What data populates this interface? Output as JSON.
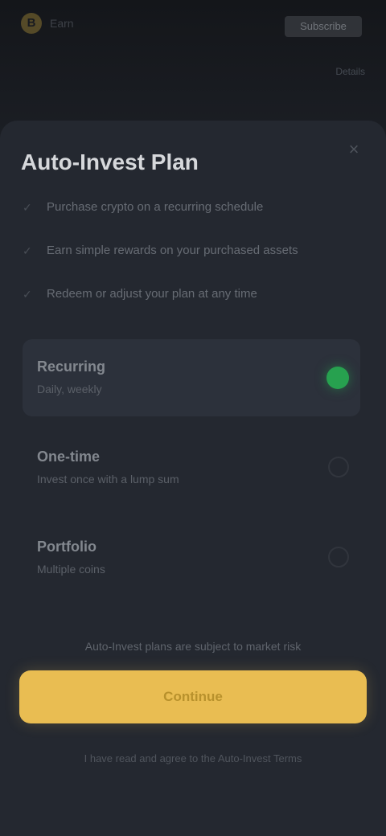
{
  "background_app": {
    "brand_logo": "B",
    "brand_name": "Earn",
    "top_action_label": "Subscribe",
    "subline": "Details"
  },
  "sheet": {
    "title": "Auto-Invest Plan",
    "close_icon": "×",
    "bullets": [
      "Purchase crypto on a recurring schedule",
      "Earn simple rewards on your purchased assets",
      "Redeem or adjust your plan at any time"
    ],
    "options": [
      {
        "title": "Recurring",
        "subtitle": "Daily, weekly",
        "selected": true
      },
      {
        "title": "One-time",
        "subtitle": "Invest once with a lump sum",
        "selected": false
      },
      {
        "title": "Portfolio",
        "subtitle": "Multiple coins",
        "selected": false
      }
    ],
    "note": "Auto-Invest plans are subject to market risk",
    "primary_button_label": "Continue",
    "terms": "I have read and agree to the Auto-Invest Terms"
  },
  "colors": {
    "accent": "#e9bd52",
    "selected_radio": "#27a14f",
    "sheet_bg": "#242830",
    "selected_option_bg": "#2c313b"
  }
}
